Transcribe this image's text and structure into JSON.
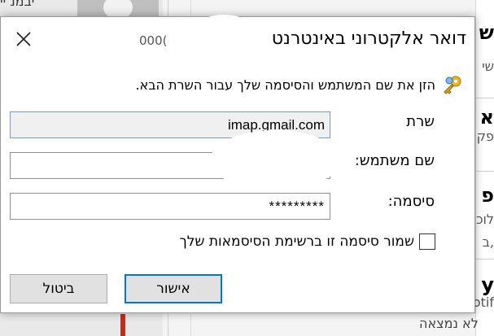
{
  "background": {
    "top_left_text": "יבמנ יי",
    "bottom_left_text": "",
    "not_found_text": "לא נמצאה",
    "right_pane_fragments": [
      {
        "text": "ש",
        "kind": "big"
      },
      {
        "text": "שי",
        "kind": "small"
      },
      {
        "text": "א",
        "kind": "big"
      },
      {
        "text": "פק",
        "kind": "small"
      },
      {
        "text": "פ",
        "kind": "big"
      },
      {
        "text": "לוכ",
        "kind": "small"
      },
      {
        "text": ",ב",
        "kind": "small"
      },
      {
        "text": "y",
        "kind": "big"
      },
      {
        "text": "otif",
        "kind": "small"
      }
    ]
  },
  "dialog": {
    "title": "דואר אלקטרוני באינטרנט",
    "title_fragment": "000(",
    "prompt": "הזן את שם המשתמש והסיסמה שלך עבור השרת הבא.",
    "fields": {
      "server": {
        "label": "שרת",
        "value": "imap.gmail.com"
      },
      "username": {
        "label": "שם משתמש:",
        "value": ""
      },
      "password": {
        "label": "סיסמה:",
        "value": "*********"
      }
    },
    "save_password_label": "שמור סיסמה זו ברשימת הסיסמאות שלך",
    "save_password_checked": false,
    "ok_label": "אישור",
    "cancel_label": "ביטול"
  },
  "colors": {
    "accent": "#0078d7",
    "button_bg": "#e1e1e1"
  }
}
